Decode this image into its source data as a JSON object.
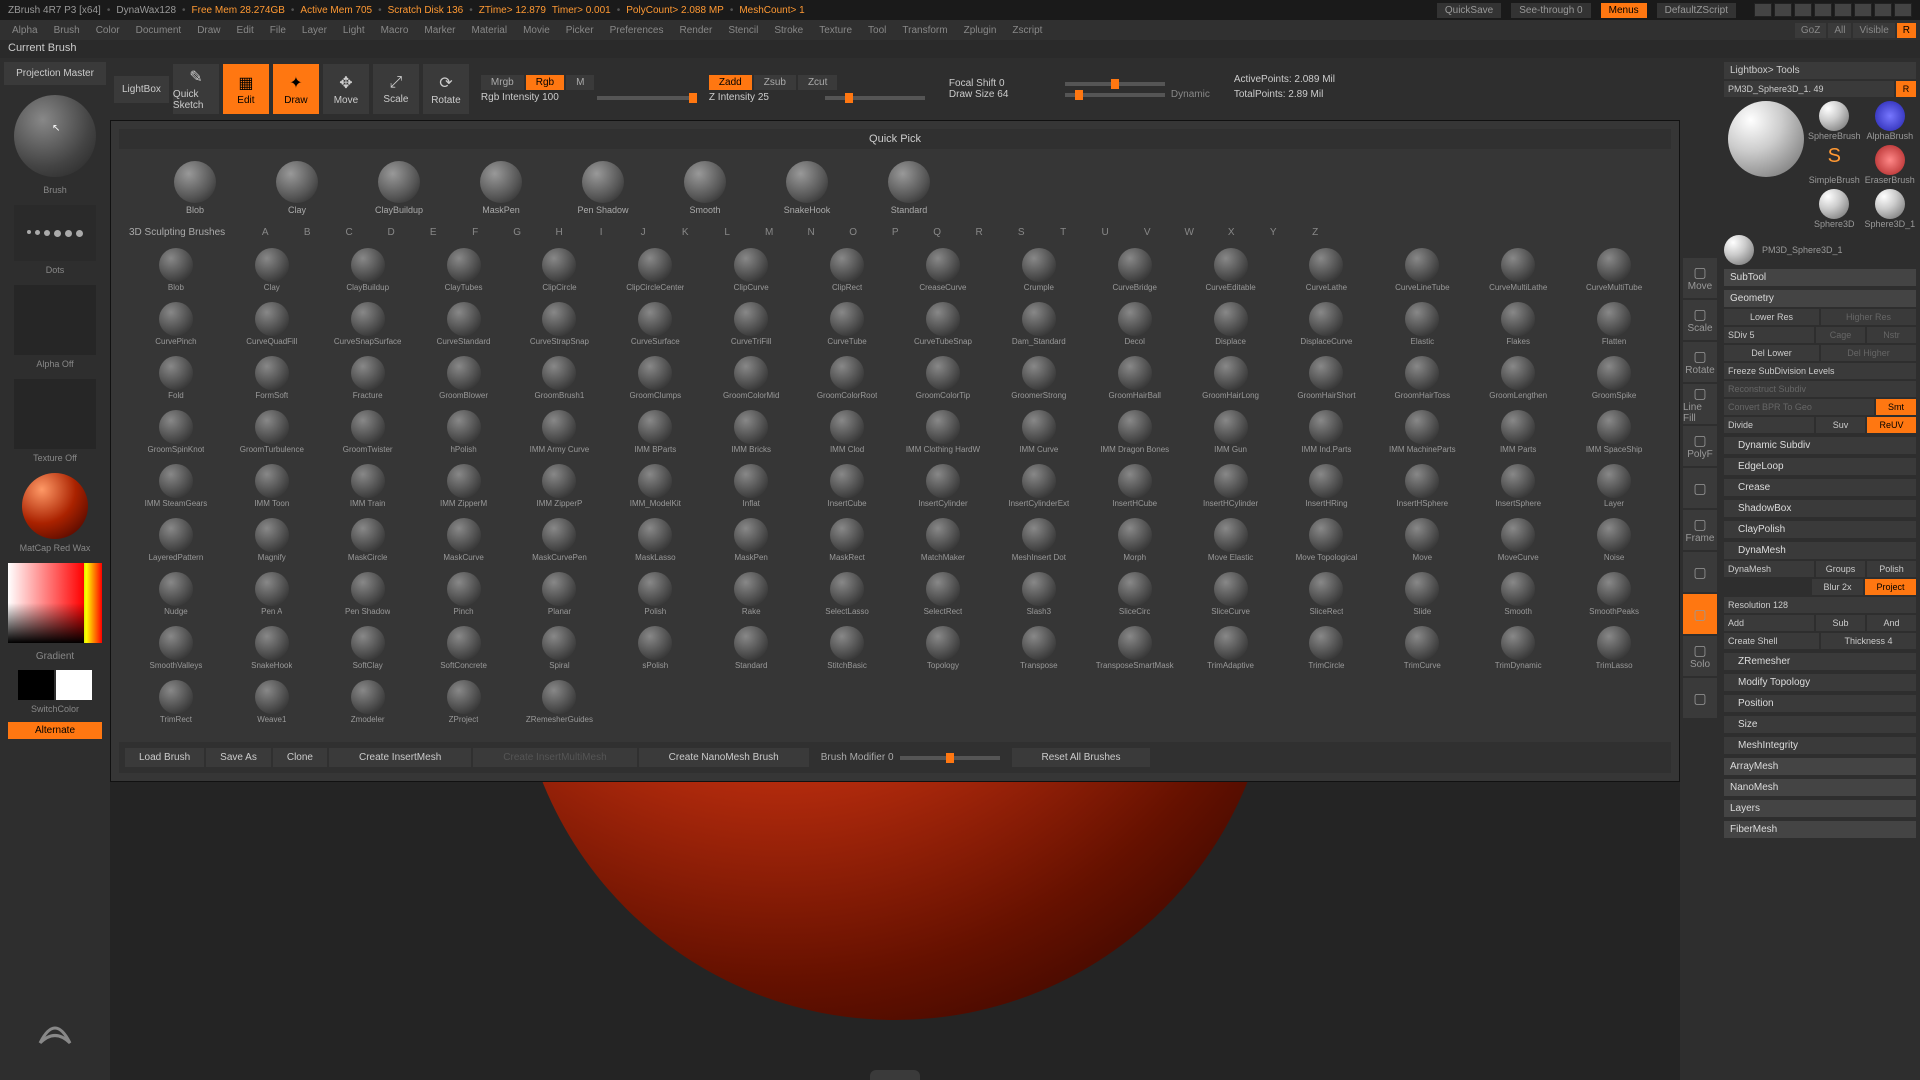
{
  "title": {
    "app": "ZBrush 4R7 P3 [x64]",
    "doc": "DynaWax128",
    "freemem": "Free Mem 28.274GB",
    "activemem": "Active Mem 705",
    "scratch": "Scratch Disk 136",
    "ztime": "ZTime> 12.879",
    "timer": "Timer> 0.001",
    "poly": "PolyCount> 2.088 MP",
    "mesh": "MeshCount> 1",
    "quicksave": "QuickSave",
    "seethrough": "See-through  0",
    "menus": "Menus",
    "script": "DefaultZScript"
  },
  "menus": [
    "Alpha",
    "Brush",
    "Color",
    "Document",
    "Draw",
    "Edit",
    "File",
    "Layer",
    "Light",
    "Macro",
    "Marker",
    "Material",
    "Movie",
    "Picker",
    "Preferences",
    "Render",
    "Stencil",
    "Stroke",
    "Texture",
    "Tool",
    "Transform",
    "Zplugin",
    "Zscript"
  ],
  "menuRight": {
    "goz": "GoZ",
    "all": "All",
    "visible": "Visible",
    "r": "R"
  },
  "status": "Current Brush",
  "leftButtons": {
    "projection": "Projection\nMaster",
    "lightbox": "LightBox"
  },
  "leftSlots": {
    "brush": "Brush",
    "stroke": "Dots",
    "alpha": "Alpha Off",
    "texture": "Texture Off",
    "matcap": "MatCap Red Wax",
    "gradient": "Gradient",
    "switch": "SwitchColor",
    "alternate": "Alternate"
  },
  "toolRow": {
    "quickSketch": "Quick\nSketch",
    "edit": "Edit",
    "draw": "Draw",
    "move": "Move",
    "scale": "Scale",
    "rotate": "Rotate",
    "mrgb": "Mrgb",
    "rgb": "Rgb",
    "m": "M",
    "rgbInt": "Rgb Intensity 100",
    "zadd": "Zadd",
    "zsub": "Zsub",
    "zcut": "Zcut",
    "zInt": "Z Intensity 25",
    "focal": "Focal Shift 0",
    "drawSize": "Draw Size 64",
    "dynamic": "Dynamic",
    "active": "ActivePoints: 2.089 Mil",
    "total": "TotalPoints: 2.89 Mil"
  },
  "popup": {
    "quickPick": "Quick Pick",
    "quickItems": [
      "Blob",
      "Clay",
      "ClayBuildup",
      "MaskPen",
      "Pen Shadow",
      "Smooth",
      "SnakeHook",
      "Standard"
    ],
    "sectionLabel": "3D Sculpting Brushes",
    "letters": [
      "A",
      "B",
      "C",
      "D",
      "E",
      "F",
      "G",
      "H",
      "I",
      "J",
      "K",
      "L",
      "M",
      "N",
      "O",
      "P",
      "Q",
      "R",
      "S",
      "T",
      "U",
      "V",
      "W",
      "X",
      "Y",
      "Z"
    ],
    "brushes": [
      "Blob",
      "Clay",
      "ClayBuildup",
      "ClayTubes",
      "ClipCircle",
      "ClipCircleCenter",
      "ClipCurve",
      "ClipRect",
      "CreaseCurve",
      "Crumple",
      "CurveBridge",
      "CurveEditable",
      "CurveLathe",
      "CurveLineTube",
      "CurveMultiLathe",
      "CurveMultiTube",
      "CurvePinch",
      "CurveQuadFill",
      "CurveSnapSurface",
      "CurveStandard",
      "CurveStrapSnap",
      "CurveSurface",
      "CurveTriFill",
      "CurveTube",
      "CurveTubeSnap",
      "Dam_Standard",
      "Decol",
      "Displace",
      "DisplaceCurve",
      "Elastic",
      "Flakes",
      "Flatten",
      "Fold",
      "FormSoft",
      "Fracture",
      "GroomBlower",
      "GroomBrush1",
      "GroomClumps",
      "GroomColorMid",
      "GroomColorRoot",
      "GroomColorTip",
      "GroomerStrong",
      "GroomHairBall",
      "GroomHairLong",
      "GroomHairShort",
      "GroomHairToss",
      "GroomLengthen",
      "GroomSpike",
      "GroomSpinKnot",
      "GroomTurbulence",
      "GroomTwister",
      "hPolish",
      "IMM Army Curve",
      "IMM BParts",
      "IMM Bricks",
      "IMM Clod",
      "IMM Clothing HardW",
      "IMM Curve",
      "IMM Dragon Bones",
      "IMM Gun",
      "IMM Ind.Parts",
      "IMM MachineParts",
      "IMM Parts",
      "IMM SpaceShip",
      "IMM SteamGears",
      "IMM Toon",
      "IMM Train",
      "IMM ZipperM",
      "IMM ZipperP",
      "IMM_ModelKit",
      "Inflat",
      "InsertCube",
      "InsertCylinder",
      "InsertCylinderExt",
      "InsertHCube",
      "InsertHCylinder",
      "InsertHRing",
      "InsertHSphere",
      "InsertSphere",
      "Layer",
      "LayeredPattern",
      "Magnify",
      "MaskCircle",
      "MaskCurve",
      "MaskCurvePen",
      "MaskLasso",
      "MaskPen",
      "MaskRect",
      "MatchMaker",
      "MeshInsert Dot",
      "Morph",
      "Move Elastic",
      "Move Topological",
      "Move",
      "MoveCurve",
      "Noise",
      "Nudge",
      "Pen A",
      "Pen Shadow",
      "Pinch",
      "Planar",
      "Polish",
      "Rake",
      "SelectLasso",
      "SelectRect",
      "Slash3",
      "SliceCirc",
      "SliceCurve",
      "SliceRect",
      "Slide",
      "Smooth",
      "SmoothPeaks",
      "SmoothValleys",
      "SnakeHook",
      "SoftClay",
      "SoftConcrete",
      "Spiral",
      "sPolish",
      "Standard",
      "StitchBasic",
      "Topology",
      "Transpose",
      "TransposeSmartMask",
      "TrimAdaptive",
      "TrimCircle",
      "TrimCurve",
      "TrimDynamic",
      "TrimLasso",
      "TrimRect",
      "Weave1",
      "Zmodeler",
      "ZProject",
      "ZRemesherGuides"
    ],
    "footer": {
      "load": "Load Brush",
      "save": "Save As",
      "clone": "Clone",
      "insert": "Create InsertMesh",
      "insertMulti": "Create InsertMultiMesh",
      "nano": "Create NanoMesh Brush",
      "modifier": "Brush Modifier 0",
      "reset": "Reset All Brushes"
    }
  },
  "rightTools": [
    "Move",
    "Scale",
    "Rotate",
    "Line Fill",
    "PolyF",
    "",
    "Frame",
    "",
    "",
    "Solo",
    ""
  ],
  "rp": {
    "lightbox": "Lightbox> Tools",
    "toolName": "PM3D_Sphere3D_1. 49",
    "r": "R",
    "tools": [
      "",
      "SphereBrush",
      "",
      "AlphaBrush",
      "SimpleBrush",
      "EraserBrush",
      "Sphere3D",
      "Sphere3D_1"
    ],
    "currentTool": "PM3D_Sphere3D_1",
    "subtool": "SubTool",
    "geometry": "Geometry",
    "lowerRes": "Lower Res",
    "higherRes": "Higher Res",
    "sdiv": "SDiv 5",
    "cage": "Cage",
    "nstr": "Nstr",
    "delLower": "Del Lower",
    "delHigher": "Del Higher",
    "freeze": "Freeze SubDivision Levels",
    "reconstruct": "Reconstruct Subdiv",
    "convert": "Convert BPR To Geo",
    "divide": "Divide",
    "smt": "Smt",
    "suv": "Suv",
    "reuv": "ReUV",
    "dynSub": "Dynamic Subdiv",
    "edgeloop": "EdgeLoop",
    "crease": "Crease",
    "shadowbox": "ShadowBox",
    "claypolish": "ClayPolish",
    "dynamesh": "DynaMesh",
    "dynameshBtn": "DynaMesh",
    "groups": "Groups",
    "polish": "Polish",
    "blur": "Blur 2x",
    "project": "Project",
    "resolution": "Resolution 128",
    "add": "Add",
    "sub": "Sub",
    "and": "And",
    "shell": "Create Shell",
    "thickness": "Thickness 4",
    "zremesher": "ZRemesher",
    "modTopo": "Modify Topology",
    "position": "Position",
    "size": "Size",
    "meshInt": "MeshIntegrity",
    "arraymesh": "ArrayMesh",
    "nanomesh": "NanoMesh",
    "layers": "Layers",
    "fibermesh": "FiberMesh"
  }
}
